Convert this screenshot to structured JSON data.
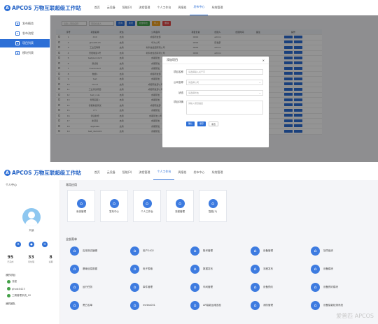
{
  "colors": {
    "accent": "#2d6fd6",
    "green": "#43a047",
    "orange": "#f0a020",
    "red": "#e04848"
  },
  "screen1": {
    "logo": "APCOS 万物互联超级工作站",
    "nav": [
      "首页",
      "云设备",
      "智能(3)",
      "流程管理",
      "个人工作台",
      "周报档",
      "发布中心",
      "系统管理"
    ],
    "nav_active_index": 6,
    "sidebar": [
      {
        "label": "发布概览",
        "icon": "grid-icon"
      },
      {
        "label": "发布流程",
        "icon": "flow-icon"
      },
      {
        "label": "项目列表",
        "icon": "list-icon"
      },
      {
        "label": "模块列表",
        "icon": "module-icon"
      }
    ],
    "sidebar_active_index": 2,
    "toolbar": {
      "search_placeholder": "请输入项目名称",
      "search2_placeholder": "项目负责人",
      "buttons": [
        "查询",
        "新增",
        "批量导出",
        "导入",
        "删除"
      ]
    },
    "table": {
      "headers": [
        "",
        "序号",
        "项目名称",
        "状态",
        "公司名称",
        "项目负责",
        "创建人",
        "创建时间",
        "备注",
        "操作"
      ],
      "rows": [
        [
          "1",
          "XXX",
          "启用",
          "成都研发部",
          "0000",
          "admin"
        ],
        [
          "2",
          "ghost0123",
          "启用",
          "华为公司",
          "0000",
          "研发部"
        ],
        [
          "3",
          "工业互联网",
          "启用",
          "新科技集团有限公司",
          "0000",
          "admin"
        ],
        [
          "4",
          "智能制造1号",
          "启用",
          "新科技集团有限公司",
          "0000",
          "admin"
        ],
        [
          "5",
          "testplan1123",
          "启用",
          "成都研发",
          "0000",
          "admin"
        ],
        [
          "6",
          "测试版",
          "启用",
          "成都研发",
          "0000",
          "admin"
        ],
        [
          "7",
          "mainboard",
          "启用",
          "成都研发",
          "0000",
          "admin"
        ],
        [
          "8",
          "数据1",
          "启用",
          "成都研发部",
          "0000",
          "admin"
        ],
        [
          "9",
          "test",
          "启用",
          "成都研发",
          "0000",
          "admin"
        ],
        [
          "10",
          "Cloud",
          "启用",
          "成都研发部公司",
          "0000",
          "admin"
        ],
        [
          "11",
          "工业测试项目",
          "启用",
          "成都研发部公司",
          "0000",
          "admin"
        ],
        [
          "12",
          "test_cule",
          "启用",
          "成都研发",
          "0000",
          "admin"
        ],
        [
          "13",
          "智慧园区1",
          "启用",
          "成都研发",
          "0000",
          "admin"
        ],
        [
          "14",
          "智能制造测试",
          "启用",
          "成都研发部",
          "0000",
          "admin"
        ],
        [
          "15",
          "YYY",
          "启用",
          "成都研发",
          "0000",
          "admin"
        ],
        [
          "16",
          "测试新增",
          "启用",
          "成都研发公司",
          "0000",
          "admin"
        ],
        [
          "17",
          "新项目",
          "启用",
          "成都研发",
          "0000",
          "admin"
        ],
        [
          "18",
          "appbase",
          "启用",
          "成都研发",
          "0000",
          "admin"
        ],
        [
          "19",
          "test_demo01",
          "启用",
          "成都研发",
          "0000",
          "admin"
        ]
      ]
    },
    "modal": {
      "title": "添加项目",
      "fields": [
        {
          "label": "项目名称",
          "placeholder": "请选择输入关于字"
        },
        {
          "label": "公司名称",
          "placeholder": "请选择公司"
        },
        {
          "label": "状态",
          "placeholder": "请选择状态"
        },
        {
          "label": "项目详情",
          "placeholder": "请输入项目描述"
        }
      ],
      "buttons": [
        "确认",
        "保存",
        "重置"
      ]
    }
  },
  "screen2": {
    "logo": "APCOS 万物互联超级工作站",
    "nav": [
      "首页",
      "云设备",
      "智能(3)",
      "流程管理",
      "个人工作台",
      "周报档",
      "发布中心",
      "系统管理"
    ],
    "nav_active_index": 4,
    "personal_title": "个人中心",
    "username": "刘溪",
    "stats": [
      {
        "n": "95",
        "l": "已完成"
      },
      {
        "n": "33",
        "l": "待处理"
      },
      {
        "n": "8",
        "l": "逾期"
      }
    ],
    "fav_title": "我的项目",
    "favs": [
      "流程",
      "ghost0423",
      "三期管理系统_02"
    ],
    "team_title": "我的团队",
    "common_title": "常用应用",
    "common_apps": [
      "系统管理",
      "发布中心",
      "个人工作台",
      "流程管理",
      "智能(3)"
    ],
    "all_title": "全部菜单",
    "all_apps": [
      "应用测试编辑",
      "用户2402",
      "账号管理",
      "设备管理",
      "协同组织",
      "基础信息数据",
      "电子表格",
      "数据发布",
      "流程发布",
      "设备模块",
      "运行任务",
      "事件管理",
      "车间管理",
      "设备预约",
      "设备预约模块",
      "黑白名单",
      "meteo001",
      "AR智能运维巡检",
      "消防管理",
      "设备智能检测系统"
    ],
    "watermark": "爱普匹 APCOS"
  }
}
